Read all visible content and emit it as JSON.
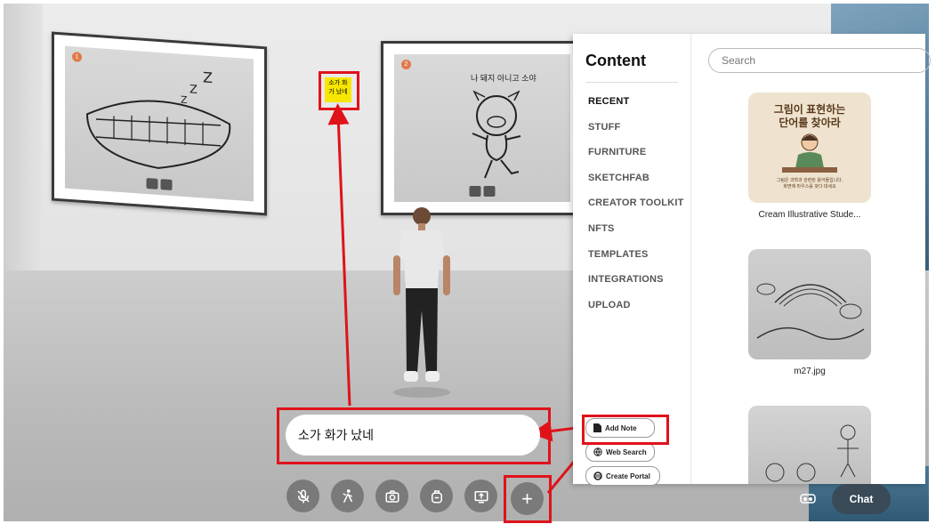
{
  "scene": {
    "frame1_badge": "1",
    "frame2_badge": "2",
    "frame2_caption": "나 돼지 아니고 소야",
    "sticky_note_text": "소가 화\n가 났네"
  },
  "chat": {
    "value": "소가 화가 났네"
  },
  "panel": {
    "title": "Content",
    "search_placeholder": "Search",
    "menu": [
      "RECENT",
      "STUFF",
      "FURNITURE",
      "SKETCHFAB",
      "CREATOR TOOLKIT",
      "NFTS",
      "TEMPLATES",
      "INTEGRATIONS",
      "UPLOAD"
    ],
    "buttons": {
      "add_note": "Add Note",
      "web_search": "Web Search",
      "create_portal": "Create Portal"
    },
    "cards": [
      {
        "caption": "Cream Illustrative Stude...",
        "thumb_title": "그림이 표현하는\n단어를 찾아라",
        "thumb_sub": "그림은 과학과 관련된 용어들입니다.\n화면에 마우스를 갖다 대세요"
      },
      {
        "caption": "m27.jpg"
      },
      {
        "caption": ""
      }
    ]
  },
  "bottom": {
    "chat_label": "Chat"
  },
  "colors": {
    "highlight": "#e0121a",
    "sticky": "#f7e600",
    "chat_button": "#3a4a57"
  }
}
